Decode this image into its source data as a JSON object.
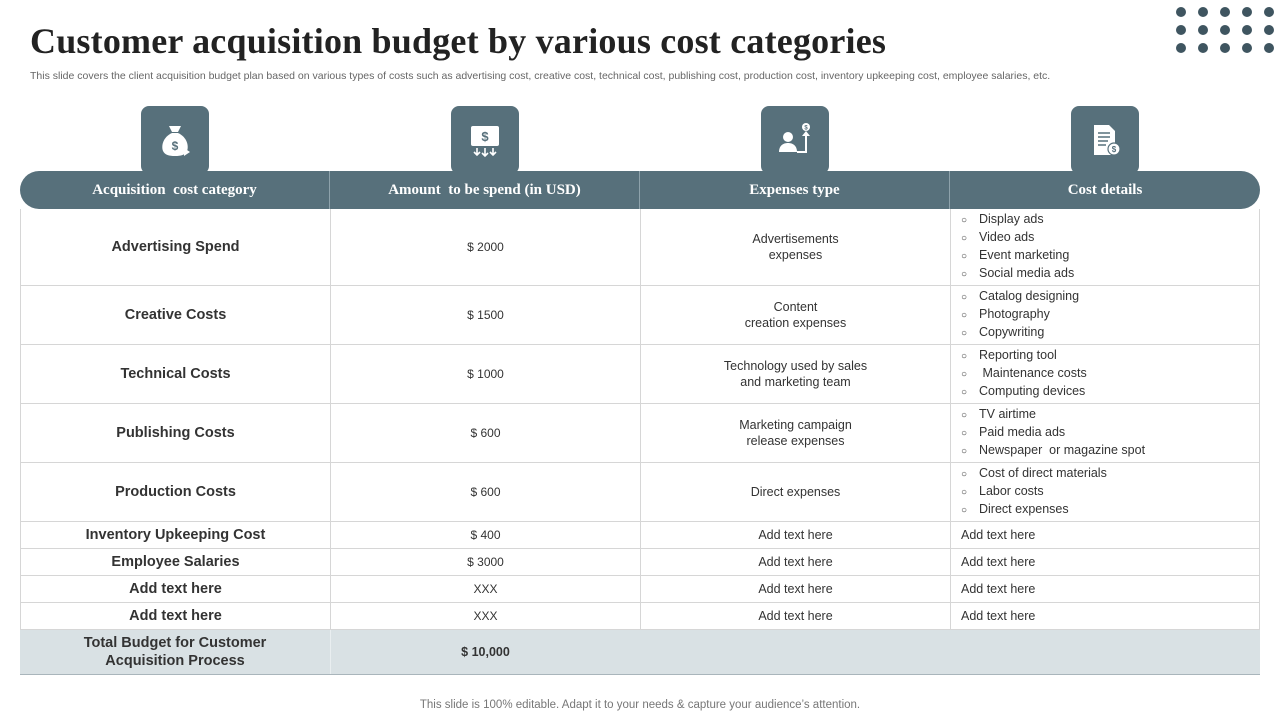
{
  "slide": {
    "title": "Customer acquisition budget by various cost categories",
    "subtitle": "This slide covers the client acquisition budget plan based on various types of costs such as advertising cost, creative cost, technical cost, publishing cost, production cost, inventory upkeeping cost, employee salaries, etc.",
    "footer": "This slide is 100% editable. Adapt it to your needs & capture your audience’s attention.",
    "accent_color": "#57707b",
    "total_row_color": "#d9e1e4"
  },
  "icons": [
    "money-bag-icon",
    "wallet-cash-icon",
    "user-growth-icon",
    "document-cost-icon"
  ],
  "headers": [
    "Acquisition  cost category",
    "Amount  to be spend (in USD)",
    "Expenses type",
    "Cost details"
  ],
  "rows": [
    {
      "category": "Advertising Spend",
      "amount": "$ 2000",
      "expense_lines": [
        "Advertisements",
        "expenses"
      ],
      "details": [
        "Display ads",
        "Video ads",
        "Event marketing",
        "Social media ads"
      ]
    },
    {
      "category": "Creative Costs",
      "amount": "$ 1500",
      "expense_lines": [
        "Content",
        "creation expenses"
      ],
      "details": [
        "Catalog designing",
        "Photography",
        "Copywriting"
      ]
    },
    {
      "category": "Technical Costs",
      "amount": "$ 1000",
      "expense_lines": [
        "Technology  used by sales",
        "and marketing team"
      ],
      "details": [
        "Reporting tool",
        " Maintenance costs",
        "Computing devices"
      ]
    },
    {
      "category": "Publishing Costs",
      "amount": "$ 600",
      "expense_lines": [
        "Marketing campaign",
        "release expenses"
      ],
      "details": [
        "TV airtime",
        "Paid media ads",
        "Newspaper  or magazine spot"
      ]
    },
    {
      "category": "Production Costs",
      "amount": "$ 600",
      "expense_lines": [
        "Direct expenses"
      ],
      "details": [
        "Cost of direct materials",
        "Labor costs",
        "Direct expenses"
      ]
    }
  ],
  "simple_rows": [
    {
      "category": "Inventory Upkeeping Cost",
      "amount": "$ 400",
      "expense": "Add text here",
      "details": "Add text here"
    },
    {
      "category": "Employee  Salaries",
      "amount": "$ 3000",
      "expense": "Add text here",
      "details": "Add text here"
    },
    {
      "category": "Add  text here",
      "amount": "XXX",
      "expense": "Add text here",
      "details": "Add text here"
    },
    {
      "category": "Add  text here",
      "amount": "XXX",
      "expense": "Add text here",
      "details": "Add text here"
    }
  ],
  "total": {
    "label_lines": [
      "Total Budget for Customer",
      "Acquisition Process"
    ],
    "amount": "$ 10,000"
  }
}
